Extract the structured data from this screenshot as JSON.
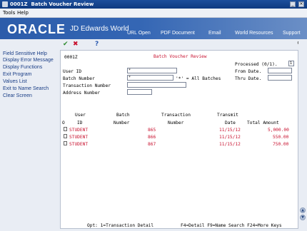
{
  "window": {
    "app_code": "0001Z",
    "title": "Batch Voucher Review"
  },
  "menu": [
    "Tools",
    "Help"
  ],
  "banner": {
    "logo": "ORACLE",
    "product": "JD Edwards World",
    "nav": [
      "URL Open",
      "PDF Document",
      "Email",
      "World Resources",
      "Support"
    ]
  },
  "sidebar": {
    "items": [
      "Field Sensitive Help",
      "Display Error Message",
      "Display Functions",
      "Exit Program",
      "Values List",
      "Exit to Name Search",
      "Clear Screen"
    ]
  },
  "toolbar": {
    "icons": [
      "check-icon",
      "cancel-icon",
      "help-icon"
    ],
    "search_icon": "search-icon"
  },
  "form": {
    "program": "0001Z",
    "title": "Batch Voucher Review",
    "processed_label": "Processed (0/1).",
    "processed_value": "1",
    "from_date_label": "From Date.",
    "from_date_value": "",
    "thru_date_label": "Thru Date.",
    "thru_date_value": "",
    "user_id_label": "User ID",
    "user_id_value": "*",
    "batch_number_label": "Batch Number",
    "batch_number_value": "*",
    "all_batches_note": "'*' = All Batches",
    "transaction_number_label": "Transaction Number",
    "transaction_number_value": "",
    "address_number_label": "Address Number",
    "address_number_value": ""
  },
  "table": {
    "headers_top": [
      "User",
      "Batch",
      "Transaction",
      "Transmit"
    ],
    "headers_bottom": [
      "O",
      "ID",
      "Number",
      "Number",
      "Date",
      "Total Amount"
    ],
    "rows": [
      {
        "user": "STUDENT",
        "batch": "865",
        "transaction": "",
        "date": "11/15/12",
        "amount": "5,000.00"
      },
      {
        "user": "STUDENT",
        "batch": "866",
        "transaction": "",
        "date": "11/15/12",
        "amount": "550.00"
      },
      {
        "user": "STUDENT",
        "batch": "867",
        "transaction": "",
        "date": "11/15/12",
        "amount": "750.00"
      }
    ]
  },
  "footer": {
    "options": "Opt:  1=Transaction Detail",
    "keys": "F4=Detail  F9=Name Search  F24=More Keys"
  },
  "colors": {
    "banner": "#2c5caa",
    "link": "#1a3e86",
    "accent_red": "#c8102e"
  }
}
